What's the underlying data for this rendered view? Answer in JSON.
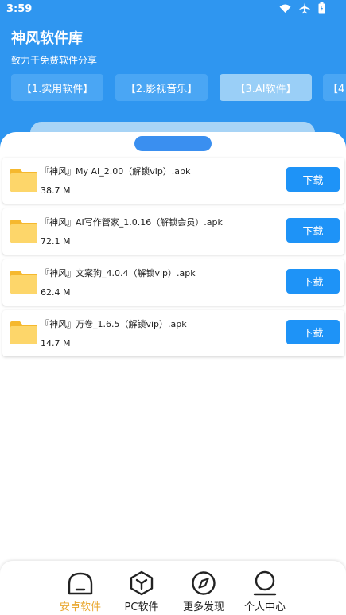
{
  "status_bar": {
    "time": "3:59"
  },
  "header": {
    "title": "神风软件库",
    "subtitle": "致力于免费软件分享"
  },
  "tabs": [
    {
      "label": "【1.实用软件】",
      "active": false
    },
    {
      "label": "【2.影视音乐】",
      "active": false
    },
    {
      "label": "【3.AI软件】",
      "active": true
    },
    {
      "label": "【4",
      "active": false
    }
  ],
  "files": [
    {
      "name": "『神风』My AI_2.00（解锁vip）.apk",
      "size": "38.7 M",
      "button": "下载"
    },
    {
      "name": "『神风』AI写作管家_1.0.16（解锁会员）.apk",
      "size": "72.1 M",
      "button": "下载"
    },
    {
      "name": "『神风』文案狗_4.0.4（解锁vip）.apk",
      "size": "62.4 M",
      "button": "下载"
    },
    {
      "name": "『神风』万卷_1.6.5（解锁vip）.apk",
      "size": "14.7 M",
      "button": "下载"
    }
  ],
  "bottom_nav": [
    {
      "label": "安卓软件",
      "icon": "android-icon",
      "active": true
    },
    {
      "label": "PC软件",
      "icon": "hexagon-icon",
      "active": false
    },
    {
      "label": "更多发现",
      "icon": "compass-icon",
      "active": false
    },
    {
      "label": "个人中心",
      "icon": "user-icon",
      "active": false
    }
  ],
  "colors": {
    "header_blue": "#2f96f0",
    "button_blue": "#1e93f7",
    "folder_yellow": "#f9c848",
    "active_nav": "#e8a52a"
  }
}
